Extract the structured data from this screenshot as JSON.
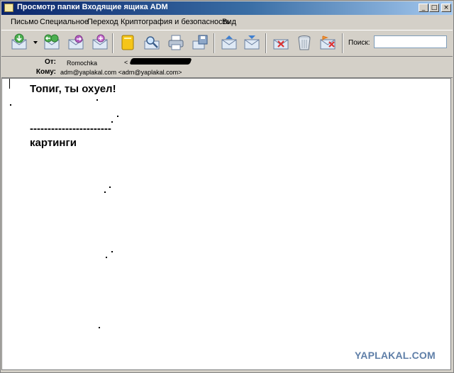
{
  "window": {
    "title": "Просмотр папки Входящие ящика ADM",
    "minimize_glyph": "_",
    "maximize_glyph": "□",
    "close_glyph": "×"
  },
  "menu": [
    {
      "label": "Письмо"
    },
    {
      "label": "Специальное"
    },
    {
      "label": "Переход"
    },
    {
      "label": "Криптография и безопасность"
    },
    {
      "label": "Вид"
    }
  ],
  "toolbar": {
    "icons": [
      "receive-mail-icon",
      "reply-icon",
      "forward-icon",
      "new-message-icon",
      "address-book-icon",
      "find-icon",
      "print-icon",
      "save-icon",
      "previous-message-icon",
      "next-message-icon",
      "delete-mark-icon",
      "trash-icon",
      "flag-delete-icon"
    ],
    "search_label": "Поиск:",
    "search_value": ""
  },
  "header": {
    "from_label": "От:",
    "from_name": "Romochka",
    "from_email_open": "<",
    "to_label": "Кому:",
    "to_value": "adm@yaplakal.com <adm@yaplakal.com>"
  },
  "message": {
    "line1": "Топиг, ты охуел!",
    "line2": "-----------------------",
    "line3": "картинги"
  },
  "watermark": "YAPLAKAL.COM",
  "colors": {
    "titlebar_start": "#0a246a",
    "titlebar_end": "#a6caf0",
    "chrome": "#d4d0c8",
    "watermark": "#5f7fa8"
  }
}
